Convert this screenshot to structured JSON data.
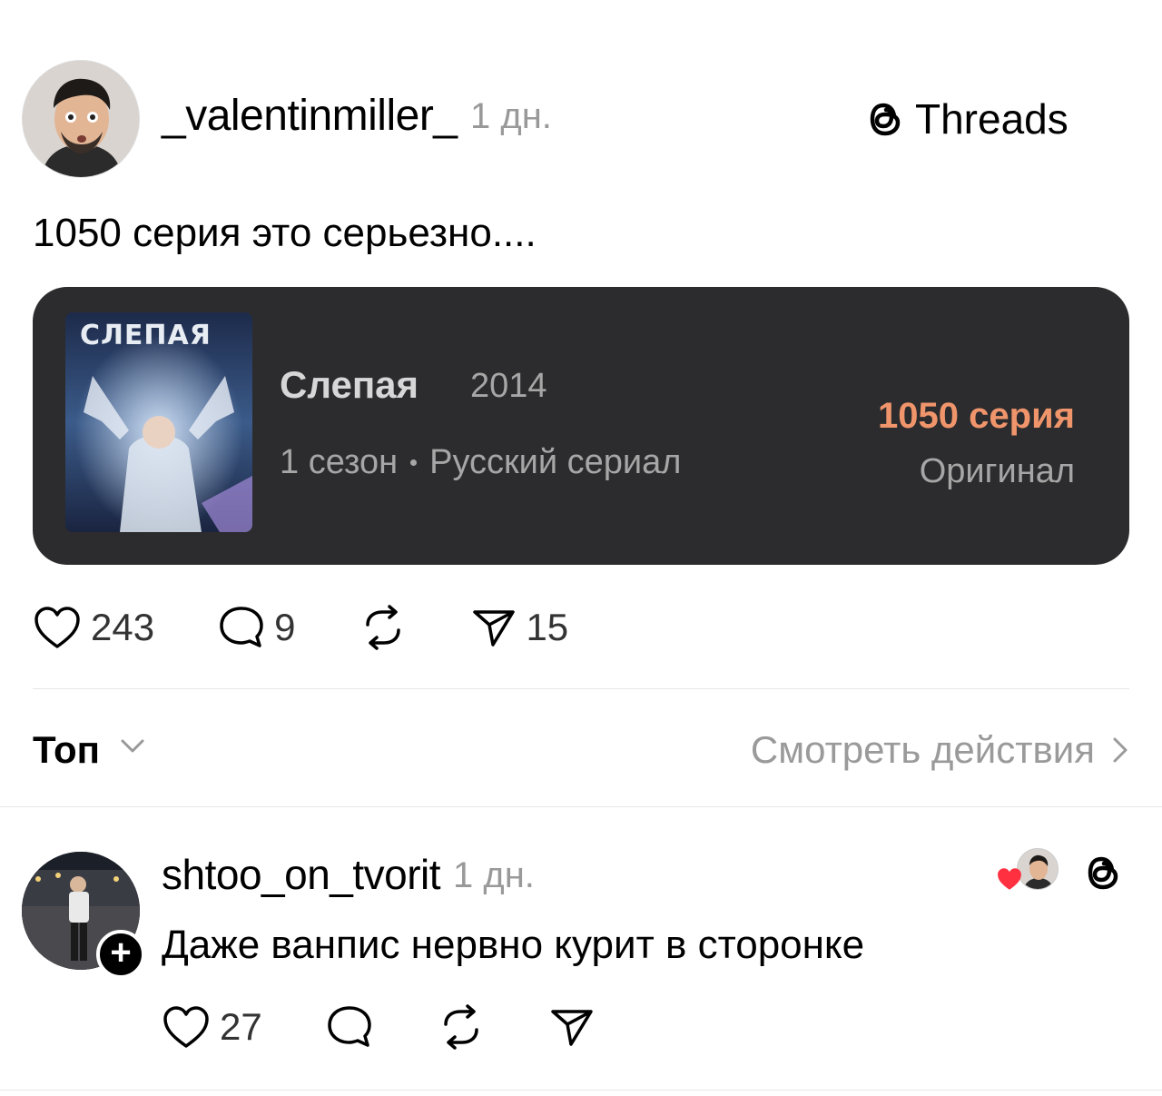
{
  "post": {
    "username": "_valentinmiller_",
    "timestamp": "1 дн.",
    "brand": "Threads",
    "text": "1050 серия это серьезно....",
    "media": {
      "poster_title": "СЛЕПАЯ",
      "title": "Слепая",
      "year": "2014",
      "season": "1 сезон",
      "genre": "Русский сериал",
      "episode": "1050 серия",
      "episode_sub": "Оригинал"
    },
    "actions": {
      "likes": "243",
      "comments": "9",
      "shares": "15"
    }
  },
  "sort_bar": {
    "label": "Топ",
    "view_activity": "Смотреть действия"
  },
  "reply": {
    "username": "shtoo_on_tvorit",
    "timestamp": "1 дн.",
    "text": "Даже ванпис нервно курит в сторонке",
    "actions": {
      "likes": "27"
    }
  },
  "colors": {
    "episode_accent": "#f0956b",
    "muted_text": "#999999",
    "heart_red": "#ff3040",
    "card_background": "#2c2c2e"
  }
}
